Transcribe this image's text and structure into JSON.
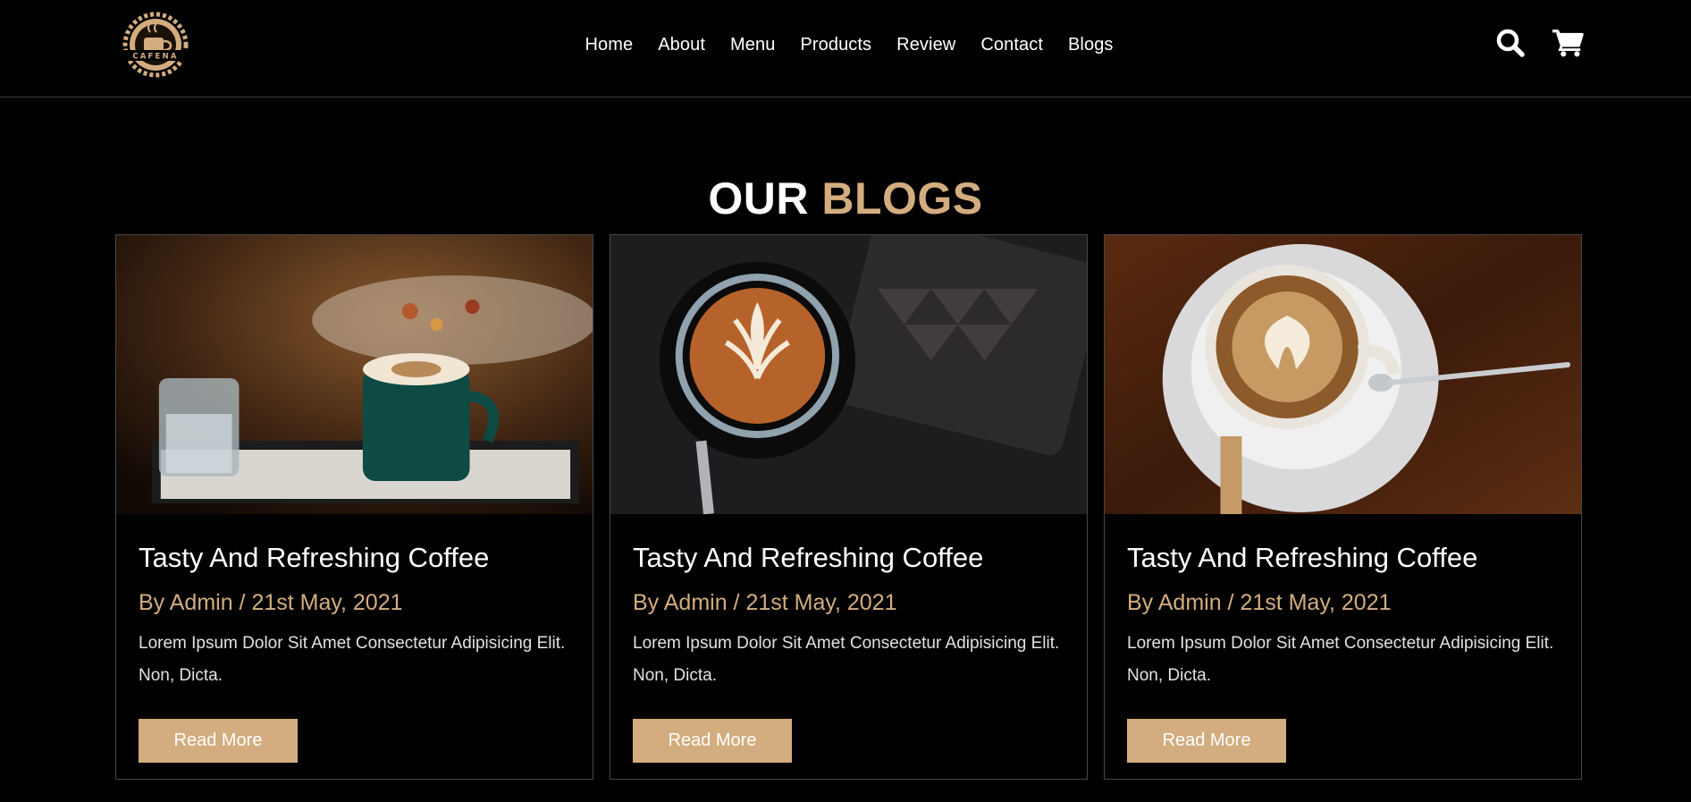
{
  "brand": {
    "logo_text": "CAFENA"
  },
  "nav": {
    "items": [
      "Home",
      "About",
      "Menu",
      "Products",
      "Review",
      "Contact",
      "Blogs"
    ]
  },
  "header_icons": [
    "search-icon",
    "cart-icon"
  ],
  "section": {
    "title_part1": "OUR",
    "title_part2": "BLOGS"
  },
  "blogs": [
    {
      "title": "Tasty And Refreshing Coffee",
      "meta": "By Admin / 21st May, 2021",
      "text": "Lorem Ipsum Dolor Sit Amet Consectetur Adipisicing Elit. Non, Dicta.",
      "button": "Read More"
    },
    {
      "title": "Tasty And Refreshing Coffee",
      "meta": "By Admin / 21st May, 2021",
      "text": "Lorem Ipsum Dolor Sit Amet Consectetur Adipisicing Elit. Non, Dicta.",
      "button": "Read More"
    },
    {
      "title": "Tasty And Refreshing Coffee",
      "meta": "By Admin / 21st May, 2021",
      "text": "Lorem Ipsum Dolor Sit Amet Consectetur Adipisicing Elit. Non, Dicta.",
      "button": "Read More"
    }
  ],
  "colors": {
    "background": "#010101",
    "accent": "#d3ad7f",
    "text": "#ffffff",
    "border": "#474747"
  }
}
